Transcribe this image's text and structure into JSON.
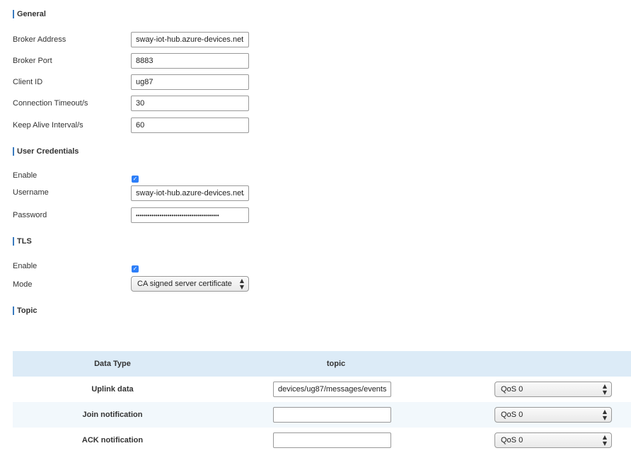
{
  "sections": {
    "general": "General",
    "credentials": "User Credentials",
    "tls": "TLS",
    "topic": "Topic"
  },
  "general": {
    "broker_address_label": "Broker Address",
    "broker_address_value": "sway-iot-hub.azure-devices.net",
    "broker_port_label": "Broker Port",
    "broker_port_value": "8883",
    "client_id_label": "Client ID",
    "client_id_value": "ug87",
    "timeout_label": "Connection Timeout/s",
    "timeout_value": "30",
    "keepalive_label": "Keep Alive Interval/s",
    "keepalive_value": "60"
  },
  "credentials": {
    "enable_label": "Enable",
    "enable_checked": true,
    "username_label": "Username",
    "username_value": "sway-iot-hub.azure-devices.net/",
    "password_label": "Password",
    "password_value": "••••••••••••••••••••••••••••••••••••••••••"
  },
  "tls": {
    "enable_label": "Enable",
    "enable_checked": true,
    "mode_label": "Mode",
    "mode_value": "CA signed server certificate"
  },
  "topic_table": {
    "headers": [
      "Data Type",
      "topic"
    ],
    "rows": [
      {
        "type": "Uplink data",
        "topic": "devices/ug87/messages/events",
        "qos": "QoS 0"
      },
      {
        "type": "Join notification",
        "topic": "",
        "qos": "QoS 0"
      },
      {
        "type": "ACK notification",
        "topic": "",
        "qos": "QoS 0"
      }
    ]
  },
  "icons": {
    "checkbox": "checkmark-icon",
    "select": "up-down-arrows-icon"
  },
  "colors": {
    "accent": "#3a7bbf",
    "checkbox": "#2d7ff9",
    "table_header": "#dcebf7",
    "table_alt_row": "#f2f8fc"
  }
}
